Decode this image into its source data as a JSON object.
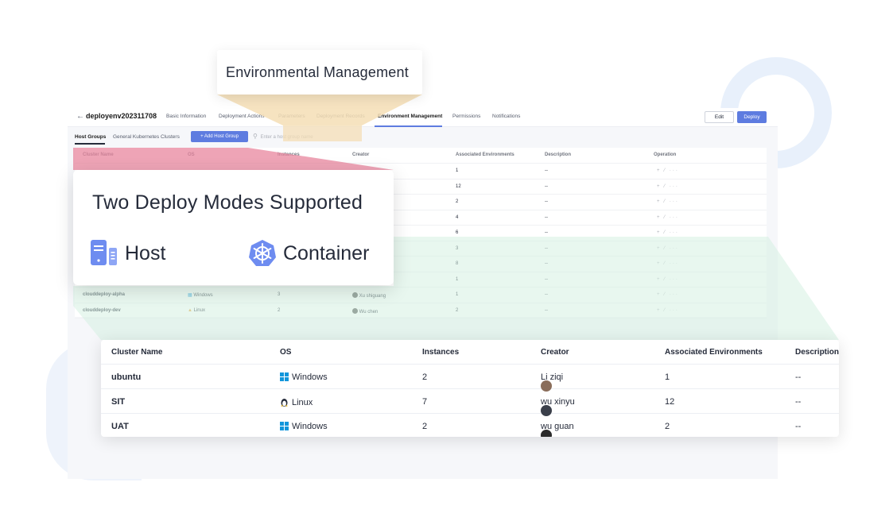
{
  "callout": {
    "environment_title": "Environmental Management"
  },
  "header": {
    "project_name": "deployenv202311708",
    "tabs": [
      "Basic Information",
      "Deployment Actions",
      "Parameters",
      "Deployment Records",
      "Environment Management",
      "Permissions",
      "Notifications"
    ],
    "active_tab": "Environment Management",
    "edit_label": "Edit",
    "deploy_label": "Deploy"
  },
  "subtabs": {
    "items": [
      "Host Groups",
      "General Kubernetes Clusters"
    ],
    "add_button": "+ Add Host Group",
    "search_placeholder": "Enter a host group name"
  },
  "background_table": {
    "headers": [
      "Cluster Name",
      "OS",
      "Instances",
      "Creator",
      "Associated Environments",
      "Description",
      "Operation"
    ],
    "rows": [
      {
        "assoc": "1",
        "desc": "--"
      },
      {
        "assoc": "12",
        "desc": "--"
      },
      {
        "assoc": "2",
        "desc": "--"
      },
      {
        "assoc": "4",
        "desc": "--"
      },
      {
        "assoc": "6",
        "desc": "--"
      },
      {
        "assoc": "3",
        "desc": "--"
      },
      {
        "assoc": "8",
        "desc": "--"
      },
      {
        "assoc": "1",
        "desc": "--"
      },
      {
        "name": "clouddeploy-alpha",
        "os": "Windows",
        "instances": "3",
        "creator": "Xu shiguang",
        "assoc": "1",
        "desc": "--"
      },
      {
        "name": "clouddeploy-dev",
        "os": "Linux",
        "instances": "2",
        "creator": "Wu chen",
        "assoc": "2",
        "desc": "--"
      }
    ],
    "ops": "+ ⁄ ···"
  },
  "modes_card": {
    "title": "Two Deploy Modes Supported",
    "host_label": "Host",
    "container_label": "Container"
  },
  "zoom_table": {
    "headers": [
      "Cluster Name",
      "OS",
      "Instances",
      "Creator",
      "Associated Environments",
      "Description"
    ],
    "rows": [
      {
        "name": "ubuntu",
        "os": "Windows",
        "instances": "2",
        "creator": "Li ziqi",
        "assoc": "1",
        "desc": "--"
      },
      {
        "name": "SIT",
        "os": "Linux",
        "instances": "7",
        "creator": "wu xinyu",
        "assoc": "12",
        "desc": "--"
      },
      {
        "name": "UAT",
        "os": "Windows",
        "instances": "2",
        "creator": "wu guan",
        "assoc": "2",
        "desc": "--"
      }
    ]
  },
  "colors": {
    "accent": "#5e7ce0",
    "pink_wedge": "#e8869e",
    "green_wedge": "#d6f0e2",
    "tan_wedge": "#f4deb5"
  }
}
